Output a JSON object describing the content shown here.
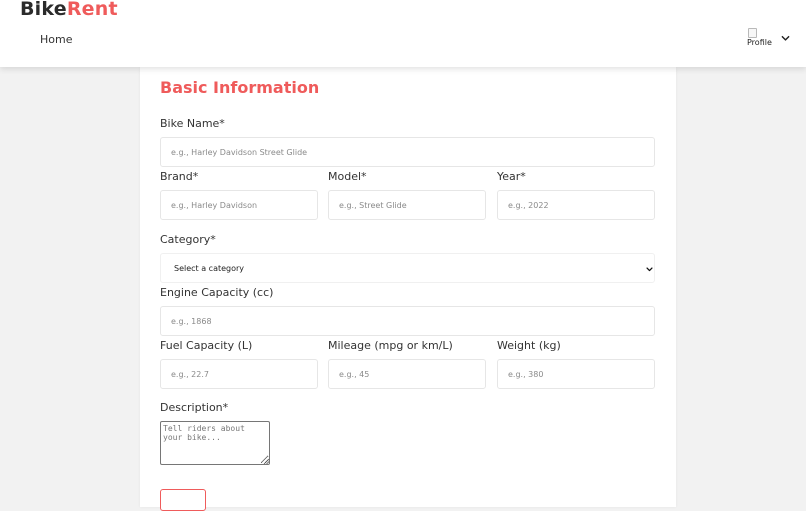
{
  "brand": {
    "part1": "Bike",
    "part2": "Rent"
  },
  "nav": {
    "home": "Home"
  },
  "profile": {
    "alt_text": "Profile"
  },
  "form": {
    "title": "Basic Information",
    "bike_name": {
      "label": "Bike Name*",
      "placeholder": "e.g., Harley Davidson Street Glide"
    },
    "brand": {
      "label": "Brand*",
      "placeholder": "e.g., Harley Davidson"
    },
    "model": {
      "label": "Model*",
      "placeholder": "e.g., Street Glide"
    },
    "year": {
      "label": "Year*",
      "placeholder": "e.g., 2022"
    },
    "category": {
      "label": "Category*",
      "selected": "Select a category"
    },
    "engine": {
      "label": "Engine Capacity (cc)",
      "placeholder": "e.g., 1868"
    },
    "fuel": {
      "label": "Fuel Capacity (L)",
      "placeholder": "e.g., 22.7"
    },
    "mileage": {
      "label": "Mileage (mpg or km/L)",
      "placeholder": "e.g., 45"
    },
    "weight": {
      "label": "Weight (kg)",
      "placeholder": "e.g., 380"
    },
    "description": {
      "label": "Description*",
      "placeholder": "Tell riders about your bike..."
    }
  },
  "colors": {
    "accent": "#ef5b5b",
    "page_background": "#f2f2f2",
    "card_background": "#ffffff"
  },
  "icons": {
    "profile_menu": "chevron-down-icon",
    "select_arrow": "chevron-down-icon",
    "broken_image": "broken-image-icon"
  }
}
